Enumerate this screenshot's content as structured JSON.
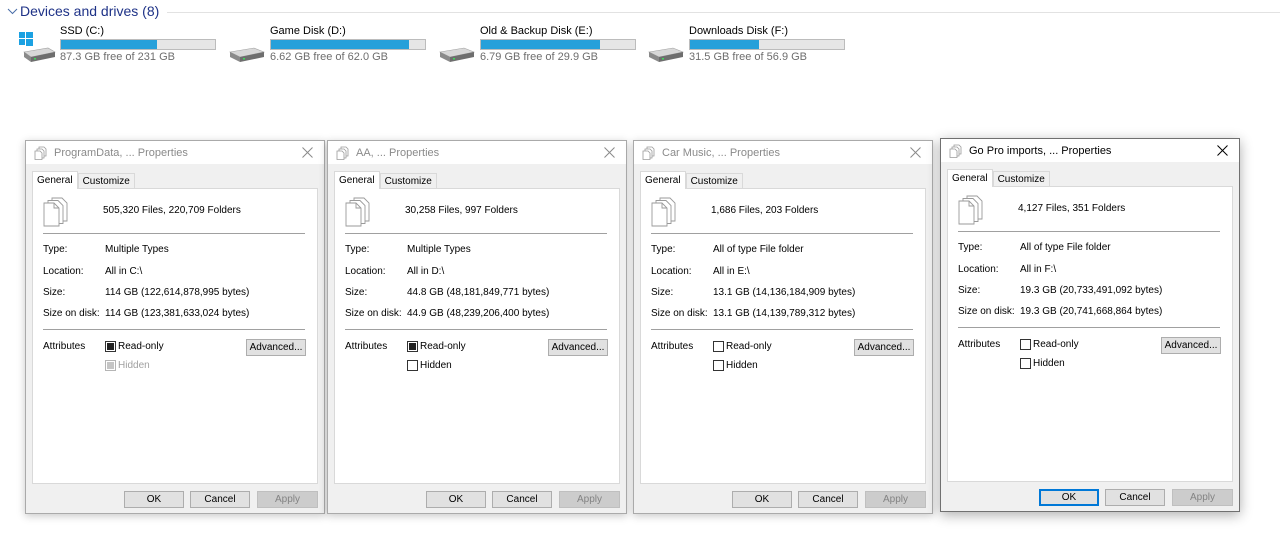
{
  "devices": {
    "header": "Devices and drives (8)",
    "drives": [
      {
        "name": "SSD (C:)",
        "free_text": "87.3 GB free of 231 GB",
        "used_fraction": 0.622,
        "icon": "windows-drive-icon"
      },
      {
        "name": "Game Disk (D:)",
        "free_text": "6.62 GB free of 62.0 GB",
        "used_fraction": 0.893,
        "icon": "hard-drive-icon"
      },
      {
        "name": "Old & Backup Disk (E:)",
        "free_text": "6.79 GB free of 29.9 GB",
        "used_fraction": 0.773,
        "icon": "hard-drive-icon"
      },
      {
        "name": "Downloads Disk (F:)",
        "free_text": "31.5 GB free of 56.9 GB",
        "used_fraction": 0.446,
        "icon": "hard-drive-icon"
      }
    ],
    "bar_color": "#26a0da"
  },
  "dialogs": [
    {
      "title": "ProgramData, ... Properties",
      "tabs": [
        "General",
        "Customize"
      ],
      "summary": "505,320 Files, 220,709 Folders",
      "fields": [
        {
          "label": "Type:",
          "value": "Multiple Types"
        },
        {
          "label": "Location:",
          "value": "All in C:\\"
        },
        {
          "label": "Size:",
          "value": "114 GB (122,614,878,995 bytes)"
        },
        {
          "label": "Size on disk:",
          "value": "114 GB (123,381,633,024 bytes)"
        }
      ],
      "attributes_label": "Attributes",
      "readonly": {
        "label": "Read-only",
        "state": "indeterminate"
      },
      "hidden": {
        "label": "Hidden",
        "state": "indeterminate-disabled"
      },
      "advanced_label": "Advanced...",
      "ok_label": "OK",
      "cancel_label": "Cancel",
      "apply_label": "Apply",
      "active": false
    },
    {
      "title": "AA, ... Properties",
      "tabs": [
        "General",
        "Customize"
      ],
      "summary": "30,258 Files, 997 Folders",
      "fields": [
        {
          "label": "Type:",
          "value": "Multiple Types"
        },
        {
          "label": "Location:",
          "value": "All in D:\\"
        },
        {
          "label": "Size:",
          "value": "44.8 GB (48,181,849,771 bytes)"
        },
        {
          "label": "Size on disk:",
          "value": "44.9 GB (48,239,206,400 bytes)"
        }
      ],
      "attributes_label": "Attributes",
      "readonly": {
        "label": "Read-only",
        "state": "indeterminate"
      },
      "hidden": {
        "label": "Hidden",
        "state": "unchecked"
      },
      "advanced_label": "Advanced...",
      "ok_label": "OK",
      "cancel_label": "Cancel",
      "apply_label": "Apply",
      "active": false
    },
    {
      "title": "Car Music, ... Properties",
      "tabs": [
        "General",
        "Customize"
      ],
      "summary": "1,686 Files, 203 Folders",
      "fields": [
        {
          "label": "Type:",
          "value": "All of type File folder"
        },
        {
          "label": "Location:",
          "value": "All in E:\\"
        },
        {
          "label": "Size:",
          "value": "13.1 GB (14,136,184,909 bytes)"
        },
        {
          "label": "Size on disk:",
          "value": "13.1 GB (14,139,789,312 bytes)"
        }
      ],
      "attributes_label": "Attributes",
      "readonly": {
        "label": "Read-only",
        "state": "unchecked"
      },
      "hidden": {
        "label": "Hidden",
        "state": "unchecked"
      },
      "advanced_label": "Advanced...",
      "ok_label": "OK",
      "cancel_label": "Cancel",
      "apply_label": "Apply",
      "active": false
    },
    {
      "title": "Go Pro imports, ... Properties",
      "tabs": [
        "General",
        "Customize"
      ],
      "summary": "4,127 Files, 351 Folders",
      "fields": [
        {
          "label": "Type:",
          "value": "All of type File folder"
        },
        {
          "label": "Location:",
          "value": "All in F:\\"
        },
        {
          "label": "Size:",
          "value": "19.3 GB (20,733,491,092 bytes)"
        },
        {
          "label": "Size on disk:",
          "value": "19.3 GB (20,741,668,864 bytes)"
        }
      ],
      "attributes_label": "Attributes",
      "readonly": {
        "label": "Read-only",
        "state": "unchecked"
      },
      "hidden": {
        "label": "Hidden",
        "state": "unchecked"
      },
      "advanced_label": "Advanced...",
      "ok_label": "OK",
      "cancel_label": "Cancel",
      "apply_label": "Apply",
      "active": true
    }
  ]
}
